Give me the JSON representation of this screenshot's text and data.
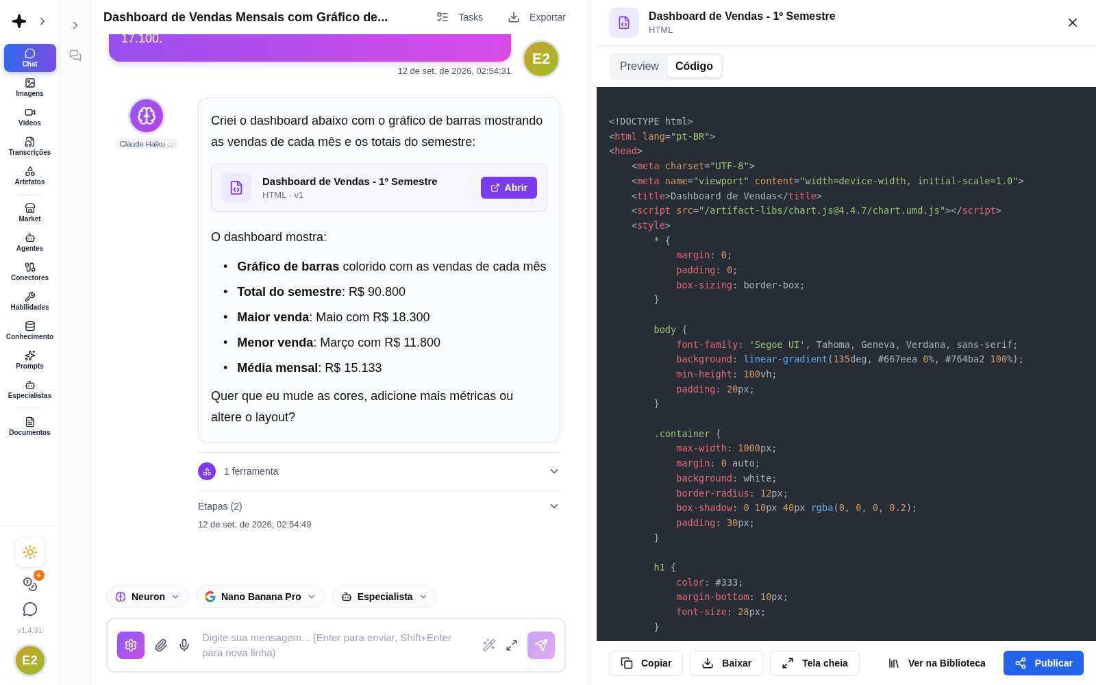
{
  "sidebar": {
    "nav_groups": [
      [
        {
          "label": "Chat",
          "selected": true
        },
        {
          "label": "Imagens",
          "selected": false
        },
        {
          "label": "Vídeos",
          "selected": false
        },
        {
          "label": "Transcrições",
          "selected": false
        },
        {
          "label": "Artefatos",
          "selected": false
        }
      ],
      [
        {
          "label": "Market",
          "selected": false
        },
        {
          "label": "Agentes",
          "selected": false
        },
        {
          "label": "Conectores",
          "selected": false
        },
        {
          "label": "Habilidades",
          "selected": false
        },
        {
          "label": "Conhecimento",
          "selected": false
        },
        {
          "label": "Prompts",
          "selected": false
        },
        {
          "label": "Especialistas",
          "selected": false
        }
      ],
      [
        {
          "label": "Documentos",
          "selected": false
        }
      ]
    ],
    "badge": "+",
    "version": "v1.4.31",
    "avatar": "E2"
  },
  "chat": {
    "title": "Dashboard de Vendas Mensais com Gráfico de...",
    "actions": [
      "Tasks",
      "Exportar"
    ],
    "user_message": {
      "text": "17.100.",
      "time": "12 de set. de 2026, 02:54:31",
      "avatar": "E2"
    },
    "assistant": {
      "name": "Claude Haiku ...",
      "intro": "Criei o dashboard abaixo com o gráfico de barras mostrando as vendas de cada mês e os totais do semestre:",
      "artifact": {
        "title": "Dashboard de Vendas - 1º Semestre",
        "meta": "HTML · v1",
        "button": "Abrir"
      },
      "lead": "O dashboard mostra:",
      "bullets": [
        {
          "marker": "•",
          "text": "**Gráfico de barras** colorido com as vendas de cada mês"
        },
        {
          "marker": "•",
          "text": "**Total do semestre**: R$ 90.800"
        },
        {
          "marker": "•",
          "text": "**Maior venda**: Maio com R$ 18.300"
        },
        {
          "marker": "•",
          "text": "**Menor venda**: Março com R$ 11.800"
        },
        {
          "marker": "•",
          "text": "**Média mensal**: R$ 15.133"
        }
      ],
      "closing": "Quer que eu mude as cores, adicione mais métricas ou altere o layout?",
      "tools": "1 ferramenta",
      "steps": "Etapas (2)",
      "time": "12 de set. de 2026, 02:54:49"
    },
    "chips": [
      "Neuron",
      "Nano Banana Pro",
      "Especialista"
    ],
    "composer": {
      "placeholder": "Digite sua mensagem... (Enter para enviar, Shift+Enter para nova linha)"
    }
  },
  "artifact_panel": {
    "title": "Dashboard de Vendas - 1º Semestre",
    "subtitle": "HTML",
    "tabs": [
      {
        "label": "Preview",
        "selected": false
      },
      {
        "label": "Código",
        "selected": true
      }
    ],
    "code_blocks": [
      [
        [
          {
            "kind": "punct",
            "text": "<!DOCTYPE html>"
          }
        ],
        [
          {
            "kind": "punct",
            "text": "<"
          },
          {
            "kind": "tag",
            "text": "html"
          },
          {
            "kind": "attr",
            "text": " lang"
          },
          {
            "kind": "punct",
            "text": "="
          },
          {
            "kind": "string",
            "text": "\"pt-BR\""
          },
          {
            "kind": "punct",
            "text": ">"
          }
        ],
        [
          {
            "kind": "punct",
            "text": "<"
          },
          {
            "kind": "tag",
            "text": "head"
          },
          {
            "kind": "punct",
            "text": ">"
          }
        ],
        [
          {
            "kind": "punct",
            "text": "    <"
          },
          {
            "kind": "tag",
            "text": "meta"
          },
          {
            "kind": "attr",
            "text": " charset"
          },
          {
            "kind": "punct",
            "text": "="
          },
          {
            "kind": "string",
            "text": "\"UTF-8\""
          },
          {
            "kind": "punct",
            "text": ">"
          }
        ],
        [
          {
            "kind": "punct",
            "text": "    <"
          },
          {
            "kind": "tag",
            "text": "meta"
          },
          {
            "kind": "attr",
            "text": " name"
          },
          {
            "kind": "punct",
            "text": "="
          },
          {
            "kind": "string",
            "text": "\"viewport\""
          },
          {
            "kind": "attr",
            "text": " content"
          },
          {
            "kind": "punct",
            "text": "="
          },
          {
            "kind": "string",
            "text": "\"width=device-width, initial-scale=1.0\""
          },
          {
            "kind": "punct",
            "text": ">"
          }
        ],
        [
          {
            "kind": "punct",
            "text": "    <"
          },
          {
            "kind": "tag",
            "text": "title"
          },
          {
            "kind": "punct",
            "text": ">Dashboard de Vendas</"
          },
          {
            "kind": "tag",
            "text": "title"
          },
          {
            "kind": "punct",
            "text": ">"
          }
        ],
        [
          {
            "kind": "punct",
            "text": "    <"
          },
          {
            "kind": "tag",
            "text": "script"
          },
          {
            "kind": "attr",
            "text": " src"
          },
          {
            "kind": "punct",
            "text": "="
          },
          {
            "kind": "string",
            "text": "\"/artifact-libs/chart.js@4.4.7/chart.umd.js\""
          },
          {
            "kind": "punct",
            "text": "></"
          },
          {
            "kind": "tag",
            "text": "script"
          },
          {
            "kind": "punct",
            "text": ">"
          }
        ],
        [
          {
            "kind": "punct",
            "text": "    <"
          },
          {
            "kind": "tag",
            "text": "style"
          },
          {
            "kind": "punct",
            "text": ">"
          }
        ],
        [
          {
            "kind": "selector",
            "text": "        *"
          },
          {
            "kind": "punct",
            "text": " {"
          }
        ],
        [
          {
            "kind": "prop",
            "text": "            margin"
          },
          {
            "kind": "punct",
            "text": ": "
          },
          {
            "kind": "number",
            "text": "0"
          },
          {
            "kind": "punct",
            "text": ";"
          }
        ],
        [
          {
            "kind": "prop",
            "text": "            padding"
          },
          {
            "kind": "punct",
            "text": ": "
          },
          {
            "kind": "number",
            "text": "0"
          },
          {
            "kind": "punct",
            "text": ";"
          }
        ],
        [
          {
            "kind": "prop",
            "text": "            box-sizing"
          },
          {
            "kind": "punct",
            "text": ": border-box;"
          }
        ],
        [
          {
            "kind": "punct",
            "text": "        }"
          }
        ]
      ],
      [
        [
          {
            "kind": "selector",
            "text": "        body"
          },
          {
            "kind": "punct",
            "text": " {"
          }
        ],
        [
          {
            "kind": "prop",
            "text": "            font-family"
          },
          {
            "kind": "punct",
            "text": ": "
          },
          {
            "kind": "string",
            "text": "'Segoe UI'"
          },
          {
            "kind": "punct",
            "text": ", Tahoma, Geneva, Verdana, sans-serif;"
          }
        ],
        [
          {
            "kind": "prop",
            "text": "            background"
          },
          {
            "kind": "punct",
            "text": ": "
          },
          {
            "kind": "func",
            "text": "linear-gradient"
          },
          {
            "kind": "punct",
            "text": "("
          },
          {
            "kind": "number",
            "text": "135"
          },
          {
            "kind": "punct",
            "text": "deg, #667eea "
          },
          {
            "kind": "number",
            "text": "0"
          },
          {
            "kind": "punct",
            "text": "%, #764ba2 "
          },
          {
            "kind": "number",
            "text": "100"
          },
          {
            "kind": "punct",
            "text": "%);"
          }
        ],
        [
          {
            "kind": "prop",
            "text": "            min-height"
          },
          {
            "kind": "punct",
            "text": ": "
          },
          {
            "kind": "number",
            "text": "100"
          },
          {
            "kind": "punct",
            "text": "vh;"
          }
        ],
        [
          {
            "kind": "prop",
            "text": "            padding"
          },
          {
            "kind": "punct",
            "text": ": "
          },
          {
            "kind": "number",
            "text": "20"
          },
          {
            "kind": "punct",
            "text": "px;"
          }
        ],
        [
          {
            "kind": "punct",
            "text": "        }"
          }
        ]
      ],
      [
        [
          {
            "kind": "selector",
            "text": "        .container"
          },
          {
            "kind": "punct",
            "text": " {"
          }
        ],
        [
          {
            "kind": "prop",
            "text": "            max-width"
          },
          {
            "kind": "punct",
            "text": ": "
          },
          {
            "kind": "number",
            "text": "1000"
          },
          {
            "kind": "punct",
            "text": "px;"
          }
        ],
        [
          {
            "kind": "prop",
            "text": "            margin"
          },
          {
            "kind": "punct",
            "text": ": "
          },
          {
            "kind": "number",
            "text": "0"
          },
          {
            "kind": "punct",
            "text": " auto;"
          }
        ],
        [
          {
            "kind": "prop",
            "text": "            background"
          },
          {
            "kind": "punct",
            "text": ": white;"
          }
        ],
        [
          {
            "kind": "prop",
            "text": "            border-radius"
          },
          {
            "kind": "punct",
            "text": ": "
          },
          {
            "kind": "number",
            "text": "12"
          },
          {
            "kind": "punct",
            "text": "px;"
          }
        ],
        [
          {
            "kind": "prop",
            "text": "            box-shadow"
          },
          {
            "kind": "punct",
            "text": ": "
          },
          {
            "kind": "number",
            "text": "0"
          },
          {
            "kind": "number",
            "text": " 10"
          },
          {
            "kind": "punct",
            "text": "px "
          },
          {
            "kind": "number",
            "text": "40"
          },
          {
            "kind": "punct",
            "text": "px "
          },
          {
            "kind": "func",
            "text": "rgba"
          },
          {
            "kind": "punct",
            "text": "("
          },
          {
            "kind": "number",
            "text": "0"
          },
          {
            "kind": "punct",
            "text": ", "
          },
          {
            "kind": "number",
            "text": "0"
          },
          {
            "kind": "punct",
            "text": ", "
          },
          {
            "kind": "number",
            "text": "0"
          },
          {
            "kind": "punct",
            "text": ", "
          },
          {
            "kind": "number",
            "text": "0.2"
          },
          {
            "kind": "punct",
            "text": ");"
          }
        ],
        [
          {
            "kind": "prop",
            "text": "            padding"
          },
          {
            "kind": "punct",
            "text": ": "
          },
          {
            "kind": "number",
            "text": "30"
          },
          {
            "kind": "punct",
            "text": "px;"
          }
        ],
        [
          {
            "kind": "punct",
            "text": "        }"
          }
        ]
      ],
      [
        [
          {
            "kind": "selector",
            "text": "        h1"
          },
          {
            "kind": "punct",
            "text": " {"
          }
        ],
        [
          {
            "kind": "prop",
            "text": "            color"
          },
          {
            "kind": "punct",
            "text": ": #333;"
          }
        ],
        [
          {
            "kind": "prop",
            "text": "            margin-bottom"
          },
          {
            "kind": "punct",
            "text": ": "
          },
          {
            "kind": "number",
            "text": "10"
          },
          {
            "kind": "punct",
            "text": "px;"
          }
        ],
        [
          {
            "kind": "prop",
            "text": "            font-size"
          },
          {
            "kind": "punct",
            "text": ": "
          },
          {
            "kind": "number",
            "text": "28"
          },
          {
            "kind": "punct",
            "text": "px;"
          }
        ],
        [
          {
            "kind": "punct",
            "text": "        }"
          }
        ]
      ]
    ],
    "footer": [
      {
        "label": "Copiar",
        "kind": "outline"
      },
      {
        "label": "Baixar",
        "kind": "outline"
      },
      {
        "label": "Tela cheia",
        "kind": "outline"
      },
      {
        "label": "Ver na Biblioteca",
        "kind": "plain"
      },
      {
        "label": "Publicar",
        "kind": "primary"
      }
    ]
  }
}
